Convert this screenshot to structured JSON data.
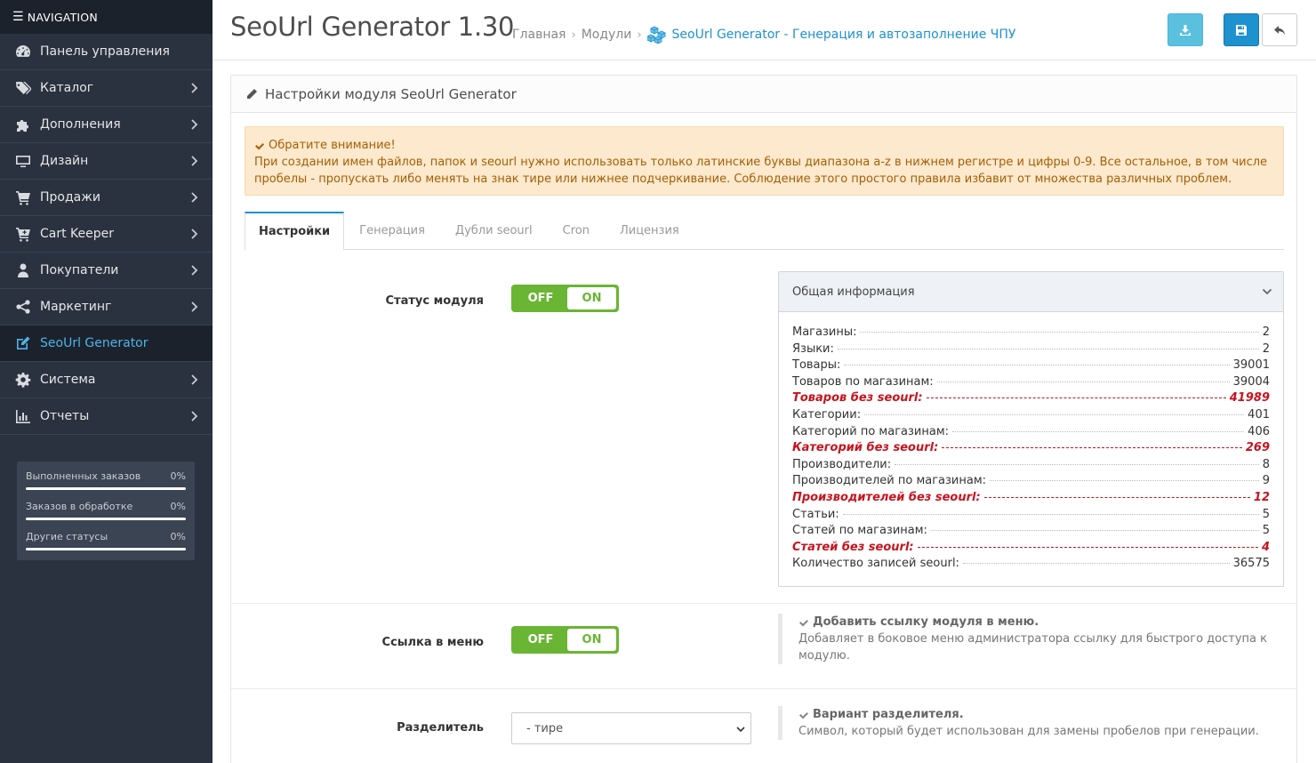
{
  "sidebar": {
    "nav_title": "NAVIGATION",
    "items": [
      {
        "label": "Панель управления",
        "icon": "dashboard-icon"
      },
      {
        "label": "Каталог",
        "icon": "tags-icon"
      },
      {
        "label": "Дополнения",
        "icon": "puzzle-icon"
      },
      {
        "label": "Дизайн",
        "icon": "monitor-icon"
      },
      {
        "label": "Продажи",
        "icon": "cart-icon"
      },
      {
        "label": "Cart Keeper",
        "icon": "cart-plus-icon"
      },
      {
        "label": "Покупатели",
        "icon": "user-icon"
      },
      {
        "label": "Маркетинг",
        "icon": "share-icon"
      },
      {
        "label": "SeoUrl Generator",
        "icon": "edit-icon"
      },
      {
        "label": "Система",
        "icon": "gear-icon"
      },
      {
        "label": "Отчеты",
        "icon": "bar-chart-icon"
      }
    ],
    "stats": [
      {
        "label": "Выполненных заказов",
        "value": "0%",
        "progress": 0
      },
      {
        "label": "Заказов в обработке",
        "value": "0%",
        "progress": 0
      },
      {
        "label": "Другие статусы",
        "value": "0%",
        "progress": 0
      }
    ]
  },
  "header": {
    "title": "SeoUrl Generator 1.30",
    "breadcrumb": [
      "Главная",
      "Модули",
      "SeoUrl Generator - Генерация и автозаполнение ЧПУ"
    ]
  },
  "panel": {
    "title": "Настройки модуля SeoUrl Generator"
  },
  "alert": {
    "title": "Обратите внимание!",
    "text": "При создании имен файлов, папок и seourl нужно использовать только латинские буквы диапазона a-z в нижнем регистре и цифры 0-9. Все остальное, в том числе пробелы - пропускать либо менять на знак тире или нижнее подчеркивание. Соблюдение этого простого правила избавит от множества различных проблем."
  },
  "tabs": [
    "Настройки",
    "Генерация",
    "Дубли seourl",
    "Cron",
    "Лицензия"
  ],
  "form": {
    "status_label": "Статус модуля",
    "menu_link_label": "Ссылка в меню",
    "separator_label": "Разделитель",
    "toggle_off": "OFF",
    "toggle_on": "ON",
    "separator_value": "- тире"
  },
  "info": {
    "title": "Общая информация",
    "rows": [
      {
        "label": "Магазины:",
        "value": "2",
        "warn": false
      },
      {
        "label": "Языки:",
        "value": "2",
        "warn": false
      },
      {
        "label": "Товары:",
        "value": "39001",
        "warn": false
      },
      {
        "label": "Товаров по магазинам:",
        "value": "39004",
        "warn": false
      },
      {
        "label": "Товаров без seourl:",
        "value": "41989",
        "warn": true
      },
      {
        "label": "Категории:",
        "value": "401",
        "warn": false
      },
      {
        "label": "Категорий по магазинам:",
        "value": "406",
        "warn": false
      },
      {
        "label": "Категорий без seourl:",
        "value": "269",
        "warn": true
      },
      {
        "label": "Производители:",
        "value": "8",
        "warn": false
      },
      {
        "label": "Производителей по магазинам:",
        "value": "9",
        "warn": false
      },
      {
        "label": "Производителей без seourl:",
        "value": "12",
        "warn": true
      },
      {
        "label": "Статьи:",
        "value": "5",
        "warn": false
      },
      {
        "label": "Статей по магазинам:",
        "value": "5",
        "warn": false
      },
      {
        "label": "Статей без seourl:",
        "value": "4",
        "warn": true
      },
      {
        "label": "Количество записей seourl:",
        "value": "36575",
        "warn": false
      }
    ]
  },
  "help": {
    "menu_title": "Добавить ссылку модуля в меню.",
    "menu_text": "Добавляет в боковое меню администратора ссылку для быстрого доступа к модулю.",
    "sep_title": "Вариант разделителя.",
    "sep_text": "Символ, который будет использован для замены пробелов при генерации."
  },
  "colors": {
    "sidebar_bg": "#2a323f",
    "accent": "#1e91cf",
    "toggle_green": "#6ab534",
    "warn_red": "#c7141f",
    "alert_bg": "#fde9cd"
  }
}
